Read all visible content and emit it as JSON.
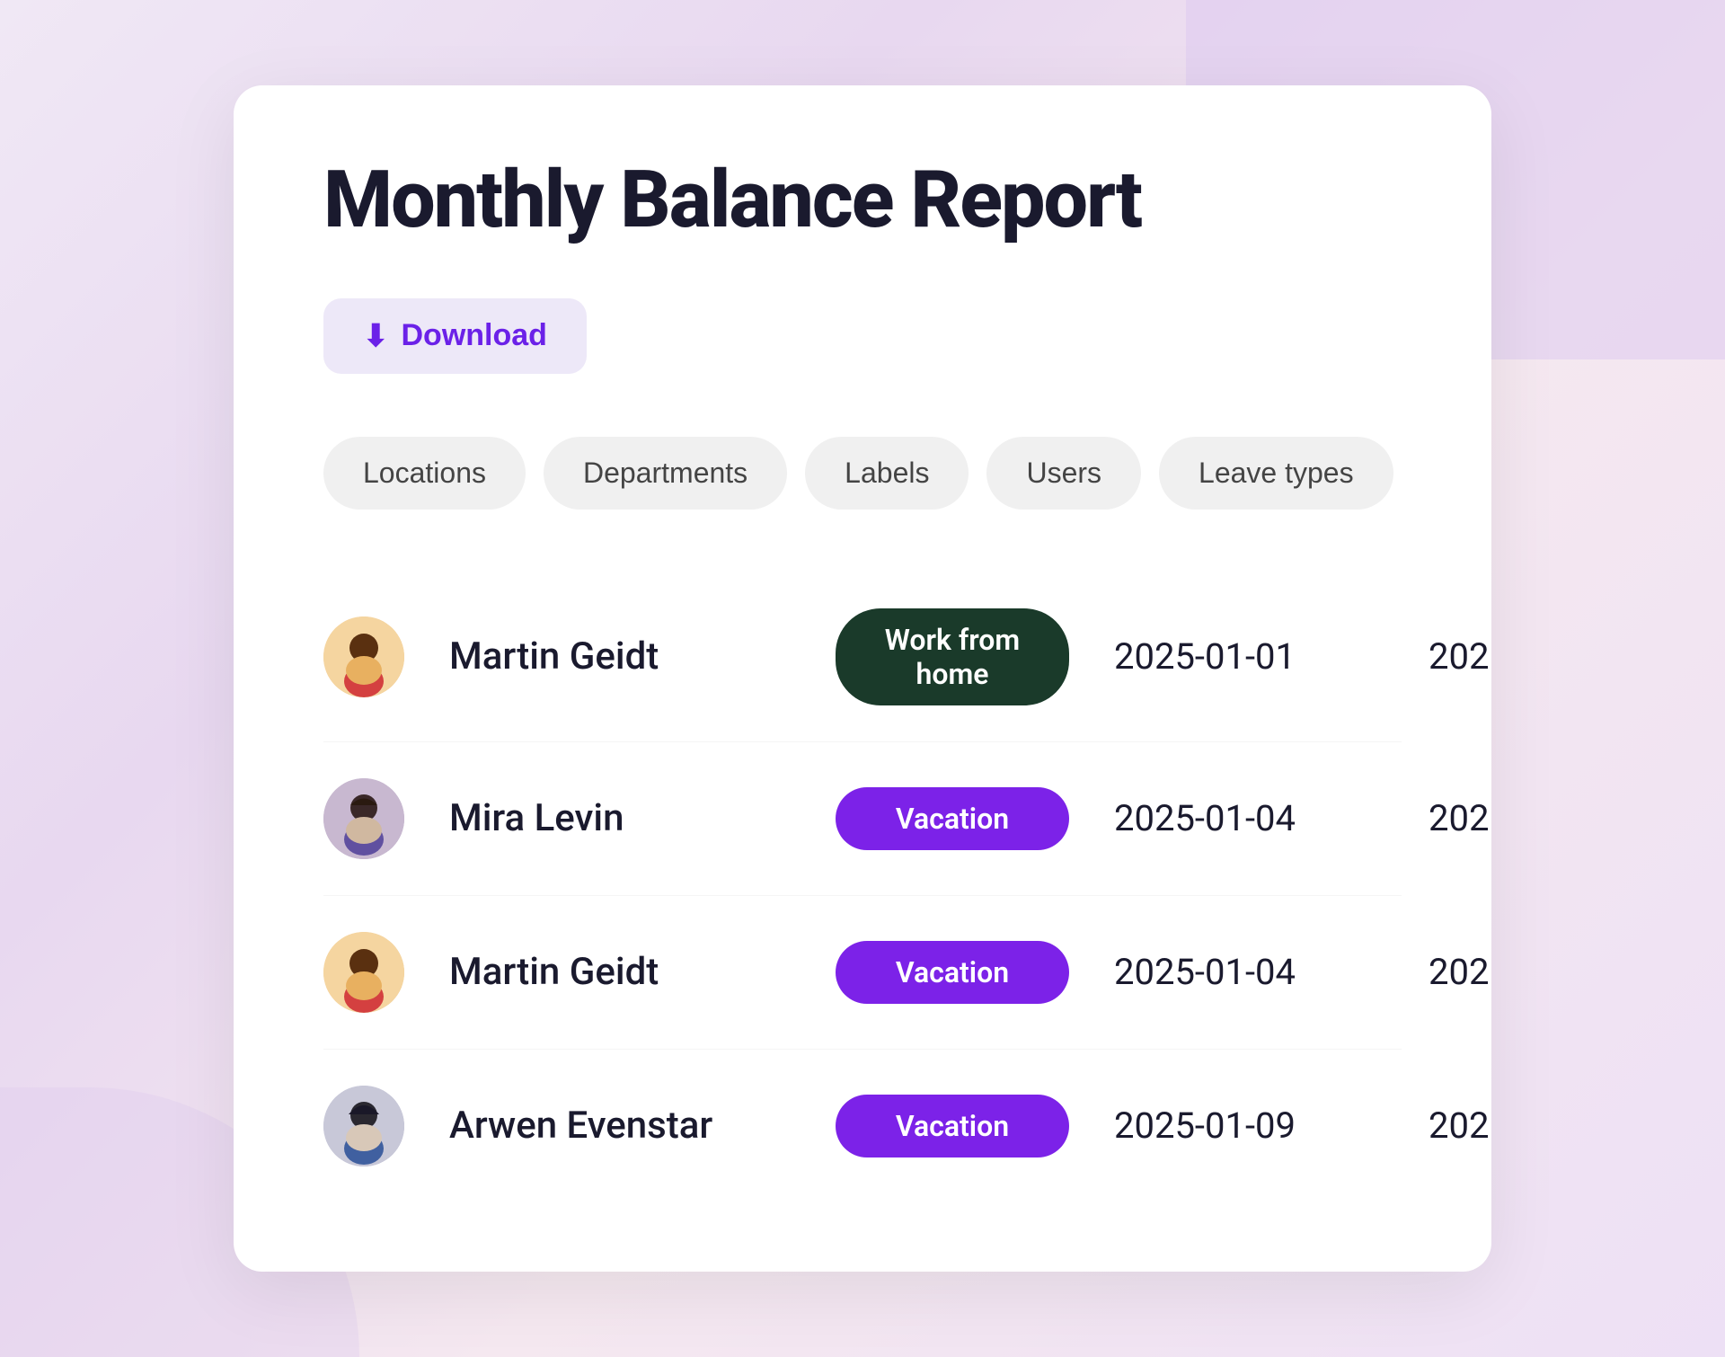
{
  "page": {
    "title": "Monthly Balance Report",
    "background_color": "#f0e8f5"
  },
  "download_button": {
    "label": "Download",
    "icon": "⬇"
  },
  "filter_tabs": [
    {
      "id": "locations",
      "label": "Locations"
    },
    {
      "id": "departments",
      "label": "Departments"
    },
    {
      "id": "labels",
      "label": "Labels"
    },
    {
      "id": "users",
      "label": "Users"
    },
    {
      "id": "leave_types",
      "label": "Leave types"
    }
  ],
  "rows": [
    {
      "id": "row-1",
      "user": "Martin Geidt",
      "avatar_type": "martin1",
      "leave_type": "Work from home",
      "badge_style": "work-from-home",
      "date_start": "2025-01-01",
      "date_end_partial": "202"
    },
    {
      "id": "row-2",
      "user": "Mira Levin",
      "avatar_type": "mira",
      "leave_type": "Vacation",
      "badge_style": "vacation",
      "date_start": "2025-01-04",
      "date_end_partial": "202"
    },
    {
      "id": "row-3",
      "user": "Martin Geidt",
      "avatar_type": "martin2",
      "leave_type": "Vacation",
      "badge_style": "vacation",
      "date_start": "2025-01-04",
      "date_end_partial": "202"
    },
    {
      "id": "row-4",
      "user": "Arwen Evenstar",
      "avatar_type": "arwen",
      "leave_type": "Vacation",
      "badge_style": "vacation",
      "date_start": "2025-01-09",
      "date_end_partial": "202"
    }
  ]
}
